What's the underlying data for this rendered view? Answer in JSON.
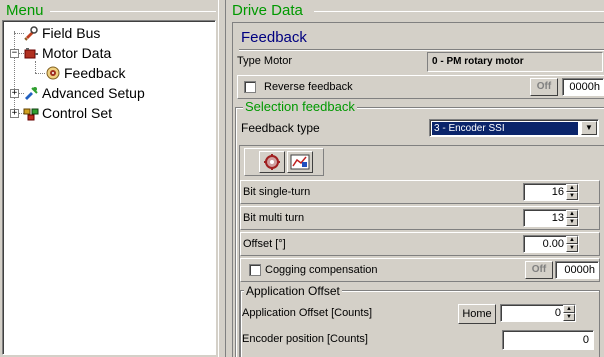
{
  "menu": {
    "title": "Menu",
    "items": [
      {
        "label": "Field Bus",
        "icon": "hand-wrench-icon"
      },
      {
        "label": "Motor Data",
        "icon": "motor-icon"
      },
      {
        "label": "Feedback",
        "icon": "feedback-icon"
      },
      {
        "label": "Advanced Setup",
        "icon": "advanced-setup-icon"
      },
      {
        "label": "Control Set",
        "icon": "control-set-icon"
      }
    ]
  },
  "drive": {
    "title": "Drive Data",
    "section_title": "Feedback",
    "type_motor_label": "Type Motor",
    "type_motor_value": "0 - PM rotary motor",
    "reverse_label": "Reverse feedback",
    "reverse_state": "Off",
    "reverse_hex": "0000h",
    "selection_group": "Selection feedback",
    "feedback_type_label": "Feedback type",
    "feedback_type_value": "3 - Encoder SSI",
    "bit_single_label": "Bit single-turn",
    "bit_single_value": "16",
    "bit_multi_label": "Bit multi turn",
    "bit_multi_value": "13",
    "offset_label": "Offset [°]",
    "offset_value": "0.00",
    "cogging_label": "Cogging compensation",
    "cogging_state": "Off",
    "cogging_hex": "0000h",
    "app_offset_group": "Application Offset",
    "app_offset_label": "Application Offset [Counts]",
    "home_label": "Home",
    "app_offset_value": "0",
    "encoder_pos_label": "Encoder position [Counts]",
    "encoder_pos_value": "0"
  },
  "colors": {
    "header_green": "#009900",
    "section_blue": "#000080",
    "selection_bg": "#0a246a"
  }
}
